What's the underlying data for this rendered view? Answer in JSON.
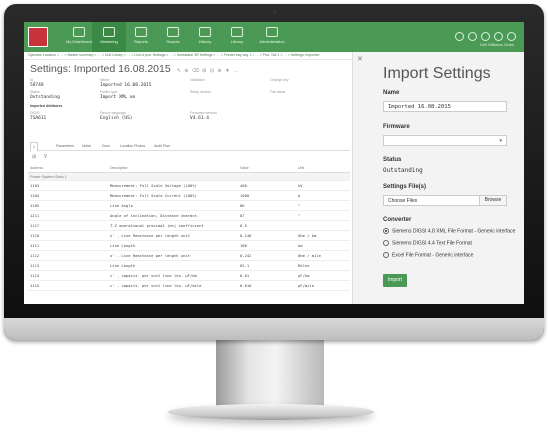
{
  "nav": {
    "items": [
      {
        "label": "My Dashboard",
        "icon": "home-icon"
      },
      {
        "label": "Mastering",
        "icon": "org-icon"
      },
      {
        "label": "Reports",
        "icon": "report-icon"
      },
      {
        "label": "Scopes",
        "icon": "scope-icon"
      },
      {
        "label": "History",
        "icon": "history-icon"
      },
      {
        "label": "Library",
        "icon": "library-icon"
      },
      {
        "label": "Administration",
        "icon": "admin-icon"
      }
    ],
    "user": "Dell Williams Gram"
  },
  "breadcrumb": "Operator Location > … > Master summary > … > Unit Library > … > Link A prot. Settings > … > Substation 3R Settings > … > Feeder bay bay 1 > … > Prot. Tab 1 > … > Settings: Imported",
  "page": {
    "title": "Settings: Imported 16.08.2015",
    "tools": "✎ ⊕ ⌫ ⊞ ⊟ ⊕ ▼ …"
  },
  "props": [
    {
      "key": "Id",
      "value": "58748"
    },
    {
      "key": "Name",
      "value": "Imported 16.08.2015"
    },
    {
      "key": "Validation",
      "value": ""
    },
    {
      "key": "Change key",
      "value": ""
    },
    {
      "key": "Status",
      "value": "Outstanding"
    },
    {
      "key": "Folder type",
      "value": "Import XML xm"
    },
    {
      "key": "Relay version",
      "value": ""
    },
    {
      "key": "File name",
      "value": ""
    },
    {
      "key": "Imported Attributes",
      "value": ""
    },
    {
      "key": "DIGSI",
      "value": "7SA611"
    },
    {
      "key": "Device language",
      "value": "English (US)"
    },
    {
      "key": "Firmware version",
      "value": "V4.61.4"
    }
  ],
  "tabs": [
    "1",
    "Parameters",
    "Notes",
    "Docs",
    "Location Photos",
    "Audit Plan"
  ],
  "table": {
    "headers": [
      "Address",
      "Description",
      "Value",
      "Unit"
    ],
    "group": "Power System Data 1",
    "rows": [
      [
        "1103",
        "Measurement: Full Scale Voltage (100%)",
        "400",
        "kV"
      ],
      [
        "1104",
        "Measurement: Full Scale Current (100%)",
        "1000",
        "A"
      ],
      [
        "1105",
        "Line Angle",
        "86",
        "°"
      ],
      [
        "1211",
        "Angle of inclination, Distance charact.",
        "87",
        "°"
      ],
      [
        "1117",
        "T-Z operational proximal (ms) coefficient",
        "0.5",
        ""
      ],
      [
        "1110",
        "x' - Line Reactance per length unit",
        "0.146",
        "Ohm / km"
      ],
      [
        "1111",
        "Line Length",
        "100",
        "km"
      ],
      [
        "1112",
        "x' - Line Reactance per length unit",
        "0.242",
        "Ohm / mile"
      ],
      [
        "1113",
        "Line Length",
        "62.1",
        "Miles"
      ],
      [
        "1114",
        "c' - capacit. per unit line len. µF/km",
        "0.01",
        "µF/km"
      ],
      [
        "1115",
        "c' - capacit. per unit line len. µF/mile",
        "0.016",
        "µF/mile"
      ]
    ]
  },
  "panel": {
    "title": "Import Settings",
    "name_label": "Name",
    "name_value": "Imported 16.08.2015",
    "firmware_label": "Firmware",
    "status_label": "Status",
    "status_value": "Outstanding",
    "files_label": "Settings File(s)",
    "file_placeholder": "Choose Files",
    "browse_label": "Browse",
    "converter_label": "Converter",
    "converters": [
      {
        "label": "Siemens DIGSI 4.8 XML File Format - Generic interface",
        "selected": true
      },
      {
        "label": "Siemens DIGSI 4.4 Text File Format",
        "selected": false
      },
      {
        "label": "Excel File Format - Generic interface",
        "selected": false
      }
    ],
    "import_label": "Import"
  },
  "colors": {
    "brand": "#4a9a55",
    "accent": "#c8323a"
  }
}
